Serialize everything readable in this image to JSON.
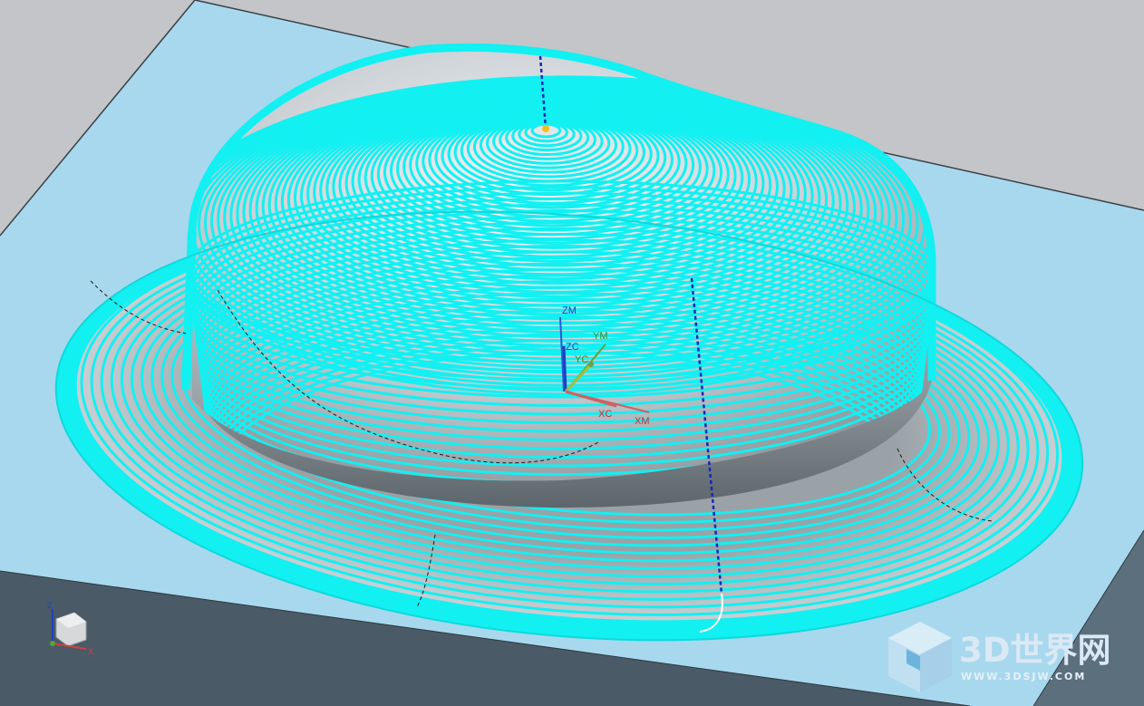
{
  "viewport": {
    "background_color": "#c9cbcd",
    "part_color": "#a8d8ee",
    "toolpath_color": "#12f0f2",
    "tool_axis_color": "#1428b8"
  },
  "csys": {
    "zm": "ZM",
    "zc": "ZC",
    "ym": "YM",
    "yc": "YC",
    "xc": "XC",
    "xm": "XM"
  },
  "view_triad": {
    "x": "X",
    "y": "Y",
    "z": "Z"
  },
  "watermark": {
    "title": "3D世界网",
    "url": "WWW.3DSJW.COM",
    "icon": "cube-logo-icon"
  }
}
